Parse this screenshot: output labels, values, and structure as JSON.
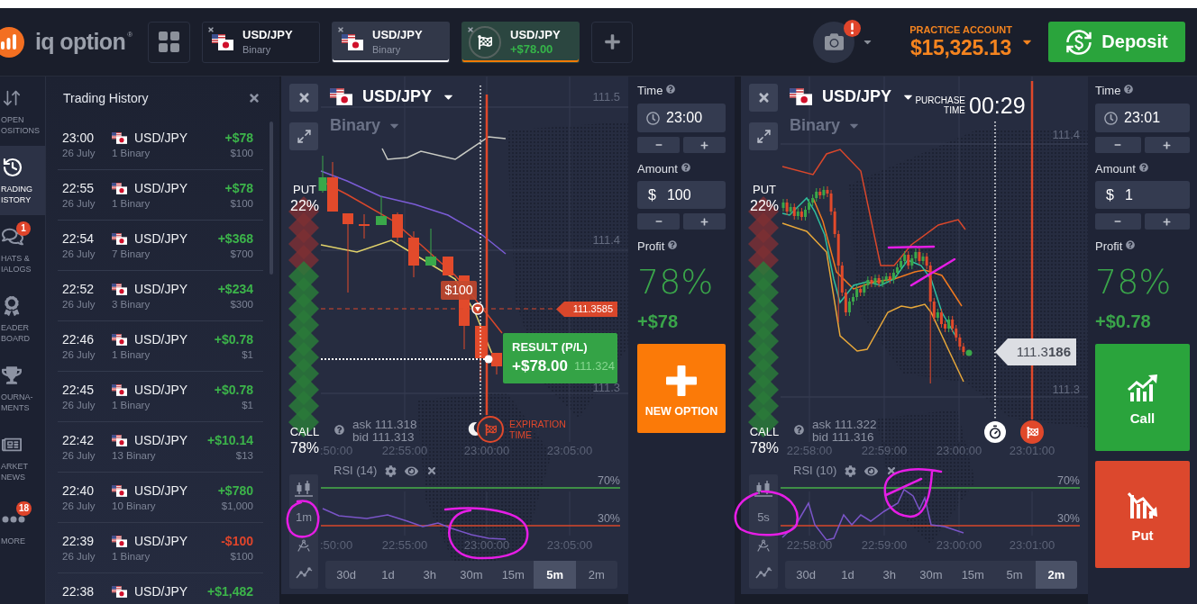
{
  "header": {
    "logo": "iq option$^{®}$",
    "tabs": [
      {
        "kind": "binary",
        "pair": "USD/JPY",
        "subtitle": "Binary",
        "selected": false
      },
      {
        "kind": "binary",
        "pair": "USD/JPY",
        "subtitle": "Binary",
        "selected": true
      },
      {
        "kind": "result",
        "pair": "USD/JPY",
        "subtitle": "+$78.00",
        "selected": false
      }
    ],
    "camera": {
      "alert": true
    },
    "account": {
      "label": "PRACTICE ACCOUNT",
      "balance": "$15,325.13"
    },
    "deposit": "Deposit"
  },
  "sidebar": {
    "items": [
      {
        "kind": "positions",
        "lines": [
          "OPEN",
          "OSITIONS"
        ],
        "selected": false
      },
      {
        "kind": "history",
        "lines": [
          "RADING",
          "ISTORY"
        ],
        "selected": true
      },
      {
        "kind": "chats",
        "lines": [
          "HATS &",
          "IALOGS"
        ],
        "selected": false,
        "badge": "1"
      },
      {
        "kind": "leaderboard",
        "lines": [
          "EADER",
          "BOARD"
        ],
        "selected": false
      },
      {
        "kind": "tournaments",
        "lines": [
          "OURNA-",
          "MENTS"
        ],
        "selected": false
      },
      {
        "kind": "news",
        "lines": [
          "ARKET",
          "NEWS"
        ],
        "selected": false
      },
      {
        "kind": "more",
        "lines": [
          "MORE"
        ],
        "selected": false,
        "badge": "18"
      }
    ]
  },
  "history": {
    "title": "Trading History",
    "rows": [
      {
        "time": "23:00",
        "date": "26 July",
        "pair": "USD/JPY",
        "count": "1 Binary",
        "result": "+$78",
        "amount": "$100",
        "kind": "win"
      },
      {
        "time": "22:55",
        "date": "26 July",
        "pair": "USD/JPY",
        "count": "1 Binary",
        "result": "+$78",
        "amount": "$100",
        "kind": "win"
      },
      {
        "time": "22:54",
        "date": "26 July",
        "pair": "USD/JPY",
        "count": "7 Binary",
        "result": "+$368",
        "amount": "$700",
        "kind": "win"
      },
      {
        "time": "22:52",
        "date": "26 July",
        "pair": "USD/JPY",
        "count": "3 Binary",
        "result": "+$234",
        "amount": "$300",
        "kind": "win"
      },
      {
        "time": "22:46",
        "date": "26 July",
        "pair": "USD/JPY",
        "count": "1 Binary",
        "result": "+$0.78",
        "amount": "$1",
        "kind": "win"
      },
      {
        "time": "22:45",
        "date": "26 July",
        "pair": "USD/JPY",
        "count": "1 Binary",
        "result": "+$0.78",
        "amount": "$1",
        "kind": "win"
      },
      {
        "time": "22:42",
        "date": "26 July",
        "pair": "USD/JPY",
        "count": "13 Binary",
        "result": "+$10.14",
        "amount": "$13",
        "kind": "win"
      },
      {
        "time": "22:40",
        "date": "26 July",
        "pair": "USD/JPY",
        "count": "10 Binary",
        "result": "+$780",
        "amount": "$1,000",
        "kind": "win"
      },
      {
        "time": "22:39",
        "date": "26 July",
        "pair": "USD/JPY",
        "count": "1 Binary",
        "result": "-$100",
        "amount": "$100",
        "kind": "loss"
      },
      {
        "time": "22:38",
        "pair": "USD/JPY",
        "result": "+$1,482",
        "kind": "win"
      }
    ]
  },
  "charts": [
    {
      "pair": "USD/JPY",
      "option_type": "Binary",
      "put": {
        "label": "PUT",
        "share": "22%"
      },
      "call": {
        "label": "CALL",
        "share": "78%"
      },
      "ask": "ask 111.318",
      "bid": "bid 111.313",
      "price_ticks": [
        "111.5",
        "111.4",
        "111.3"
      ],
      "time_ticks": [
        ":50:00",
        "22:55:00",
        "23:00:00",
        "23:05:00"
      ],
      "investment": "$100",
      "strike": "111.3585",
      "result": {
        "label": "RESULT (P/L)",
        "value": "+$78.00",
        "price": "111.324"
      },
      "expiration": [
        "EXPIRATION",
        "TIME"
      ],
      "indicator": {
        "name": "RSI (14)",
        "upper": "70%",
        "lower": "30%",
        "time_ticks": [
          ":50:00",
          "22:55:00",
          "23:00:00",
          "23:05:00"
        ]
      },
      "interval": "1m",
      "timeframes": [
        {
          "label": "30d",
          "selected": false
        },
        {
          "label": "1d",
          "selected": false
        },
        {
          "label": "3h",
          "selected": false
        },
        {
          "label": "30m",
          "selected": false
        },
        {
          "label": "15m",
          "selected": false
        },
        {
          "label": "5m",
          "selected": true
        },
        {
          "label": "2m",
          "selected": false
        }
      ]
    },
    {
      "pair": "USD/JPY",
      "option_type": "Binary",
      "put": {
        "label": "PUT",
        "share": "22%"
      },
      "call": {
        "label": "CALL",
        "share": "78%"
      },
      "ask": "ask 111.322",
      "bid": "bid 111.316",
      "price_ticks": [
        "111.4",
        "111.3"
      ],
      "time_ticks": [
        "22:58:00",
        "22:59:00",
        "23:00:00",
        "23:01:00"
      ],
      "purchase": {
        "label": [
          "PURCHASE",
          "TIME"
        ],
        "countdown": "00:29"
      },
      "price": "111.3**186**",
      "indicator": {
        "name": "RSI (10)",
        "upper": "70%",
        "lower": "30%",
        "time_ticks": [
          "22:58:00",
          "22:59:00",
          "23:00:00",
          "23:01:00"
        ]
      },
      "interval": "5s",
      "timeframes": [
        {
          "label": "30d",
          "selected": false
        },
        {
          "label": "1d",
          "selected": false
        },
        {
          "label": "3h",
          "selected": false
        },
        {
          "label": "30m",
          "selected": false
        },
        {
          "label": "15m",
          "selected": false
        },
        {
          "label": "5m",
          "selected": false
        },
        {
          "label": "2m",
          "selected": true
        }
      ]
    }
  ],
  "order_panels": [
    {
      "time_label": "Time",
      "time": "23:00",
      "amount_label": "Amount",
      "currency": "$",
      "amount": "100",
      "profit_label": "Profit",
      "profit_rate": "78%",
      "profit": "+$78",
      "actions": [
        {
          "kind": "new",
          "label": "NEW OPTION"
        }
      ]
    },
    {
      "time_label": "Time",
      "time": "23:01",
      "amount_label": "Amount",
      "currency": "$",
      "amount": "1",
      "profit_label": "Profit",
      "profit_rate": "78%",
      "profit": "+$0.78",
      "actions": [
        {
          "kind": "call",
          "label": "Call"
        },
        {
          "kind": "put",
          "label": "Put"
        }
      ]
    }
  ]
}
